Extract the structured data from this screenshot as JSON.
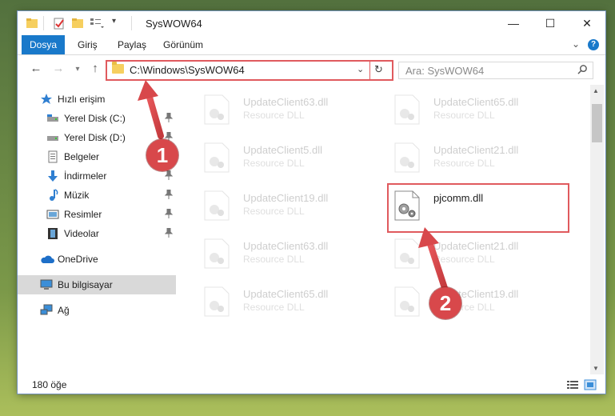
{
  "window": {
    "title": "SysWOW64"
  },
  "ribbon": {
    "tabs": [
      "Dosya",
      "Giriş",
      "Paylaş",
      "Görünüm"
    ],
    "help": "?"
  },
  "address": {
    "path": "C:\\Windows\\SysWOW64",
    "search_placeholder": "Ara: SysWOW64"
  },
  "sidebar": {
    "items": [
      {
        "label": "Hızlı erişim"
      },
      {
        "label": "Yerel Disk (C:)"
      },
      {
        "label": "Yerel Disk (D:)"
      },
      {
        "label": "Belgeler"
      },
      {
        "label": "İndirmeler"
      },
      {
        "label": "Müzik"
      },
      {
        "label": "Resimler"
      },
      {
        "label": "Videolar"
      },
      {
        "label": "OneDrive"
      },
      {
        "label": "Bu bilgisayar"
      },
      {
        "label": "Ağ"
      }
    ]
  },
  "files": [
    {
      "name": "UpdateClient63.dll",
      "type": "Resource DLL"
    },
    {
      "name": "UpdateClient65.dll",
      "type": "Resource DLL"
    },
    {
      "name": "UpdateClient5.dll",
      "type": "Resource DLL"
    },
    {
      "name": "UpdateClient21.dll",
      "type": "Resource DLL"
    },
    {
      "name": "UpdateClient19.dll",
      "type": "Resource DLL"
    },
    {
      "name": "pjcomm.dll",
      "type": ""
    },
    {
      "name": "UpdateClient63.dll",
      "type": "Resource DLL"
    },
    {
      "name": "UpdateClient21.dll",
      "type": "Resource DLL"
    },
    {
      "name": "UpdateClient65.dll",
      "type": "Resource DLL"
    },
    {
      "name": "UpdateClient19.dll",
      "type": "Resource DLL"
    }
  ],
  "status": {
    "item_count": "180 öğe"
  },
  "annotations": {
    "badge1": "1",
    "badge2": "2"
  },
  "colors": {
    "accent": "#1979ca",
    "annotation": "#d8484b"
  }
}
